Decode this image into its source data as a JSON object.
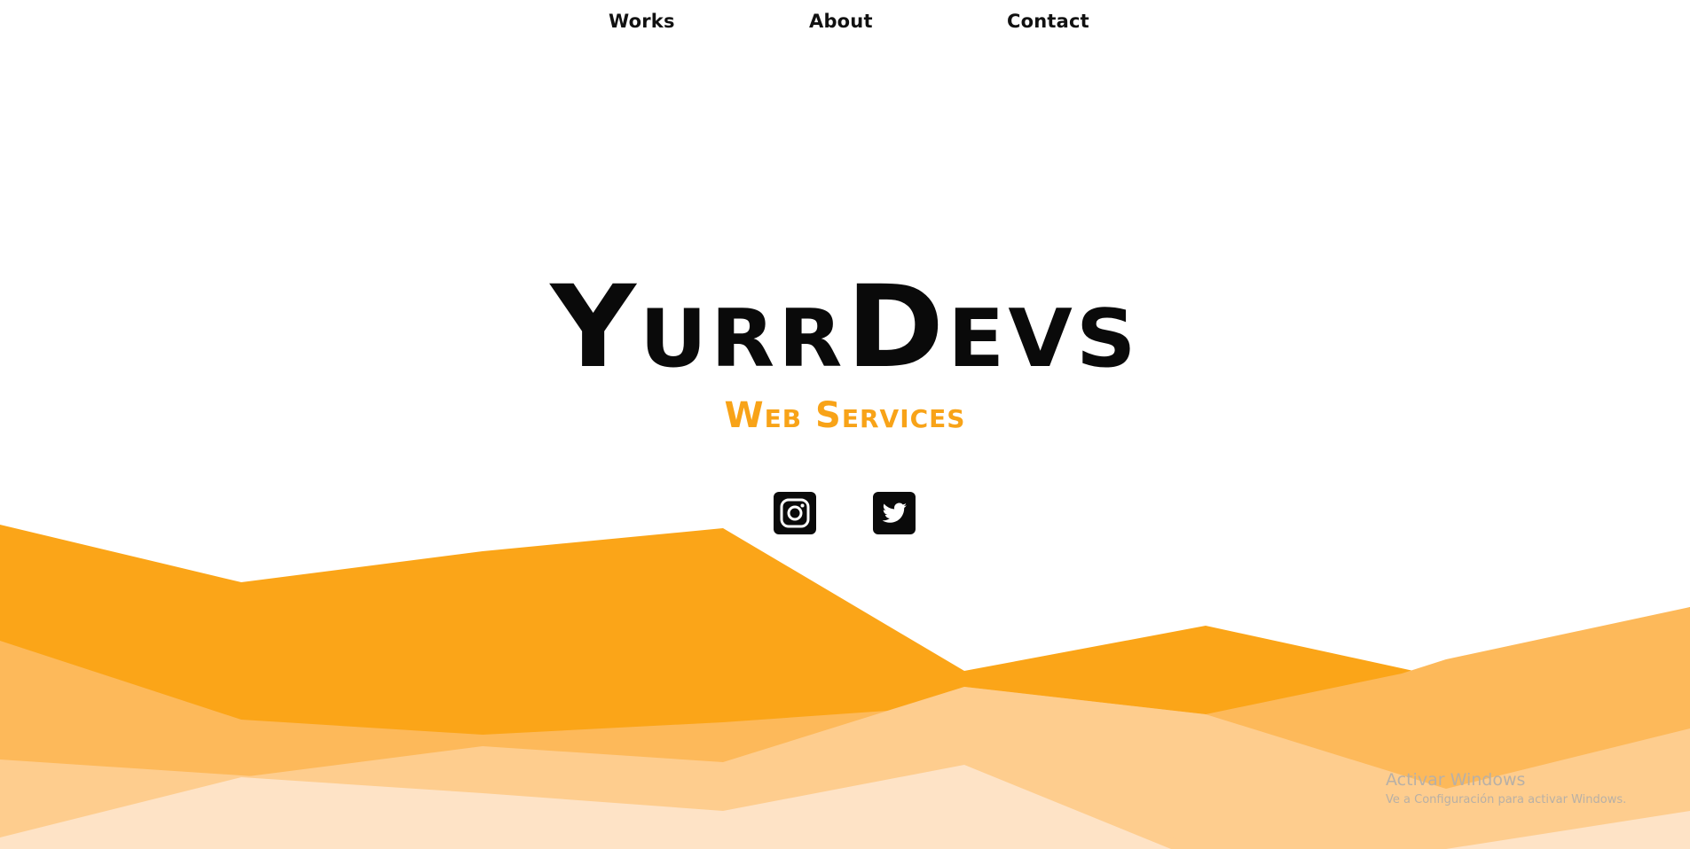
{
  "nav": {
    "items": [
      {
        "label": "Works"
      },
      {
        "label": "About"
      },
      {
        "label": "Contact"
      }
    ]
  },
  "hero": {
    "title": "YurrDevs",
    "subtitle": "Web Services"
  },
  "social": {
    "items": [
      {
        "icon": "instagram-icon"
      },
      {
        "icon": "twitter-icon"
      }
    ]
  },
  "colors": {
    "accent": "#f8a318",
    "wave_dark": "#fba518",
    "wave_mid": "#fdb95a",
    "wave_light": "#fecd8e",
    "wave_lightest": "#fee3c6",
    "icon_bg": "#0a0a0a"
  },
  "os_watermark": {
    "title": "Activar Windows",
    "subtitle": "Ve a Configuración para activar Windows."
  }
}
